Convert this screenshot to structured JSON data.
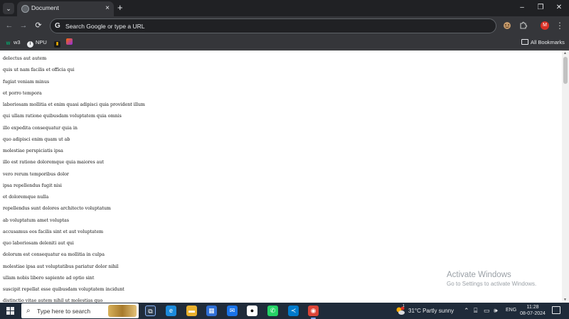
{
  "browser": {
    "tab": {
      "title": "Document",
      "close_glyph": "×"
    },
    "new_tab_glyph": "+",
    "window_controls": {
      "minimize": "–",
      "restore": "❐",
      "close": "✕"
    },
    "toolbar": {
      "back_glyph": "←",
      "forward_glyph": "→",
      "reload_glyph": "⟳",
      "omnibox_placeholder": "Search Google or type a URL",
      "google_glyph": "G",
      "profile_initial": "M",
      "menu_glyph": "⋮"
    },
    "bookmarks": [
      {
        "label": "w3",
        "icon": "w3-icon"
      },
      {
        "label": "NPU",
        "icon": "npu-icon"
      },
      {
        "label": "",
        "icon": "bookmark-icon-3"
      },
      {
        "label": "",
        "icon": "bookmark-icon-4"
      }
    ],
    "all_bookmarks_label": "All Bookmarks"
  },
  "page": {
    "items": [
      "delectus aut autem",
      "quis ut nam facilis et officia qui",
      "fugiat veniam minus",
      "et porro tempora",
      "laboriosam mollitia et enim quasi adipisci quia provident illum",
      "qui ullam ratione quibusdam voluptatem quia omnis",
      "illo expedita consequatur quia in",
      "quo adipisci enim quam ut ab",
      "molestiae perspiciatis ipsa",
      "illo est ratione doloremque quia maiores aut",
      "vero rerum temporibus dolor",
      "ipsa repellendus fugit nisi",
      "et doloremque nulla",
      "repellendus sunt dolores architecto voluptatum",
      "ab voluptatum amet voluptas",
      "accusamus eos facilis sint et aut voluptatem",
      "quo laboriosam deleniti aut qui",
      "dolorum est consequatur ea mollitia in culpa",
      "molestiae ipsa aut voluptatibus pariatur dolor nihil",
      "ullam nobis libero sapiente ad optio sint",
      "suscipit repellat esse quibusdam voluptatem incidunt",
      "distinctio vitae autem nihil ut molestias quo"
    ]
  },
  "watermark": {
    "title": "Activate Windows",
    "subtitle": "Go to Settings to activate Windows."
  },
  "taskbar": {
    "search_placeholder": "Type here to search",
    "weather": "31°C  Partly sunny",
    "weather_badge": "1",
    "language": "ENG",
    "time": "11:28",
    "date": "08-07-2024",
    "apps": [
      {
        "name": "task-view-icon",
        "glyph": "⧉",
        "color": "#2b3a4d"
      },
      {
        "name": "edge-icon",
        "glyph": "e",
        "color": "#1c8adb"
      },
      {
        "name": "file-explorer-icon",
        "glyph": "▬",
        "color": "#e8b02e"
      },
      {
        "name": "microsoft-store-icon",
        "glyph": "▦",
        "color": "#2f6fd6"
      },
      {
        "name": "mail-icon",
        "glyph": "✉",
        "color": "#1a73e8"
      },
      {
        "name": "github-icon",
        "glyph": "●",
        "color": "#ffffff"
      },
      {
        "name": "whatsapp-icon",
        "glyph": "✆",
        "color": "#25d366"
      },
      {
        "name": "vscode-icon",
        "glyph": "≺",
        "color": "#007acc"
      },
      {
        "name": "chrome-icon",
        "glyph": "◉",
        "color": "#db4437"
      }
    ]
  }
}
